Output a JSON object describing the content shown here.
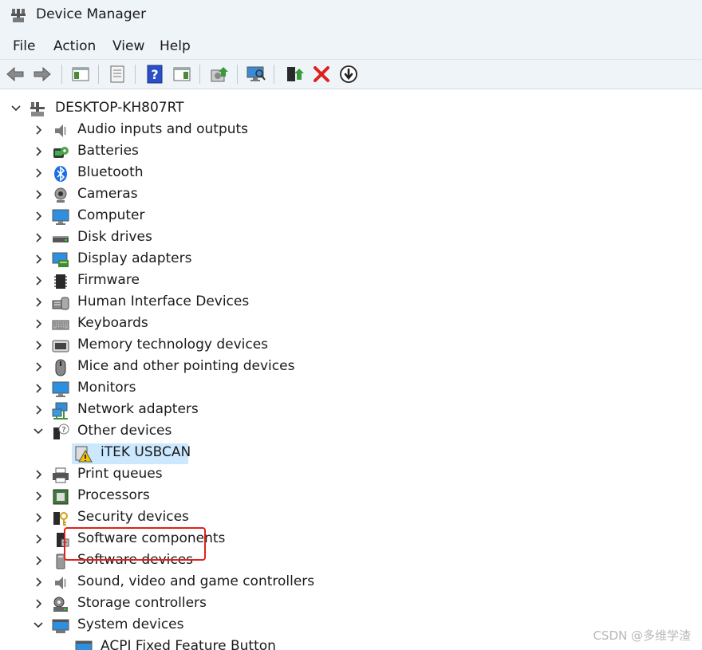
{
  "window": {
    "title": "Device Manager"
  },
  "menu": [
    "File",
    "Action",
    "View",
    "Help"
  ],
  "toolbar": {
    "buttons": [
      "back-icon",
      "forward-icon",
      "show-hide-console-tree-icon",
      "properties-icon",
      "help-icon",
      "action-pane-icon",
      "update-driver-icon",
      "scan-hardware-changes-icon",
      "enable-device-icon",
      "uninstall-device-icon",
      "disable-device-icon"
    ]
  },
  "tree": {
    "root": "DESKTOP-KH807RT",
    "categories": [
      {
        "label": "Audio inputs and outputs",
        "icon": "speaker-icon",
        "expanded": false
      },
      {
        "label": "Batteries",
        "icon": "battery-icon",
        "expanded": false
      },
      {
        "label": "Bluetooth",
        "icon": "bluetooth-icon",
        "expanded": false
      },
      {
        "label": "Cameras",
        "icon": "camera-icon",
        "expanded": false
      },
      {
        "label": "Computer",
        "icon": "computer-icon",
        "expanded": false
      },
      {
        "label": "Disk drives",
        "icon": "disk-drive-icon",
        "expanded": false
      },
      {
        "label": "Display adapters",
        "icon": "display-adapter-icon",
        "expanded": false
      },
      {
        "label": "Firmware",
        "icon": "firmware-chip-icon",
        "expanded": false
      },
      {
        "label": "Human Interface Devices",
        "icon": "hid-icon",
        "expanded": false
      },
      {
        "label": "Keyboards",
        "icon": "keyboard-icon",
        "expanded": false
      },
      {
        "label": "Memory technology devices",
        "icon": "memory-icon",
        "expanded": false
      },
      {
        "label": "Mice and other pointing devices",
        "icon": "mouse-icon",
        "expanded": false
      },
      {
        "label": "Monitors",
        "icon": "monitor-icon",
        "expanded": false
      },
      {
        "label": "Network adapters",
        "icon": "network-icon",
        "expanded": false
      },
      {
        "label": "Other devices",
        "icon": "unknown-device-icon",
        "expanded": true
      },
      {
        "label": "Print queues",
        "icon": "printer-icon",
        "expanded": false
      },
      {
        "label": "Processors",
        "icon": "processor-icon",
        "expanded": false
      },
      {
        "label": "Security devices",
        "icon": "security-device-icon",
        "expanded": false
      },
      {
        "label": "Software components",
        "icon": "software-component-icon",
        "expanded": false
      },
      {
        "label": "Software devices",
        "icon": "software-device-icon",
        "expanded": false
      },
      {
        "label": "Sound, video and game controllers",
        "icon": "sound-icon",
        "expanded": false
      },
      {
        "label": "Storage controllers",
        "icon": "storage-controller-icon",
        "expanded": false
      },
      {
        "label": "System devices",
        "icon": "system-devices-icon",
        "expanded": true
      }
    ],
    "other_devices_children": [
      {
        "label": "iTEK USBCAN",
        "icon": "warning-device-icon",
        "selected": true
      }
    ],
    "system_devices_children": [
      {
        "label": "ACPI Fixed Feature Button",
        "icon": "system-device-icon"
      }
    ]
  },
  "colors": {
    "selection": "#cce8ff",
    "highlight_box": "#e0221e",
    "chrome": "#eff4f9"
  },
  "watermark": "CSDN @多维学渣"
}
